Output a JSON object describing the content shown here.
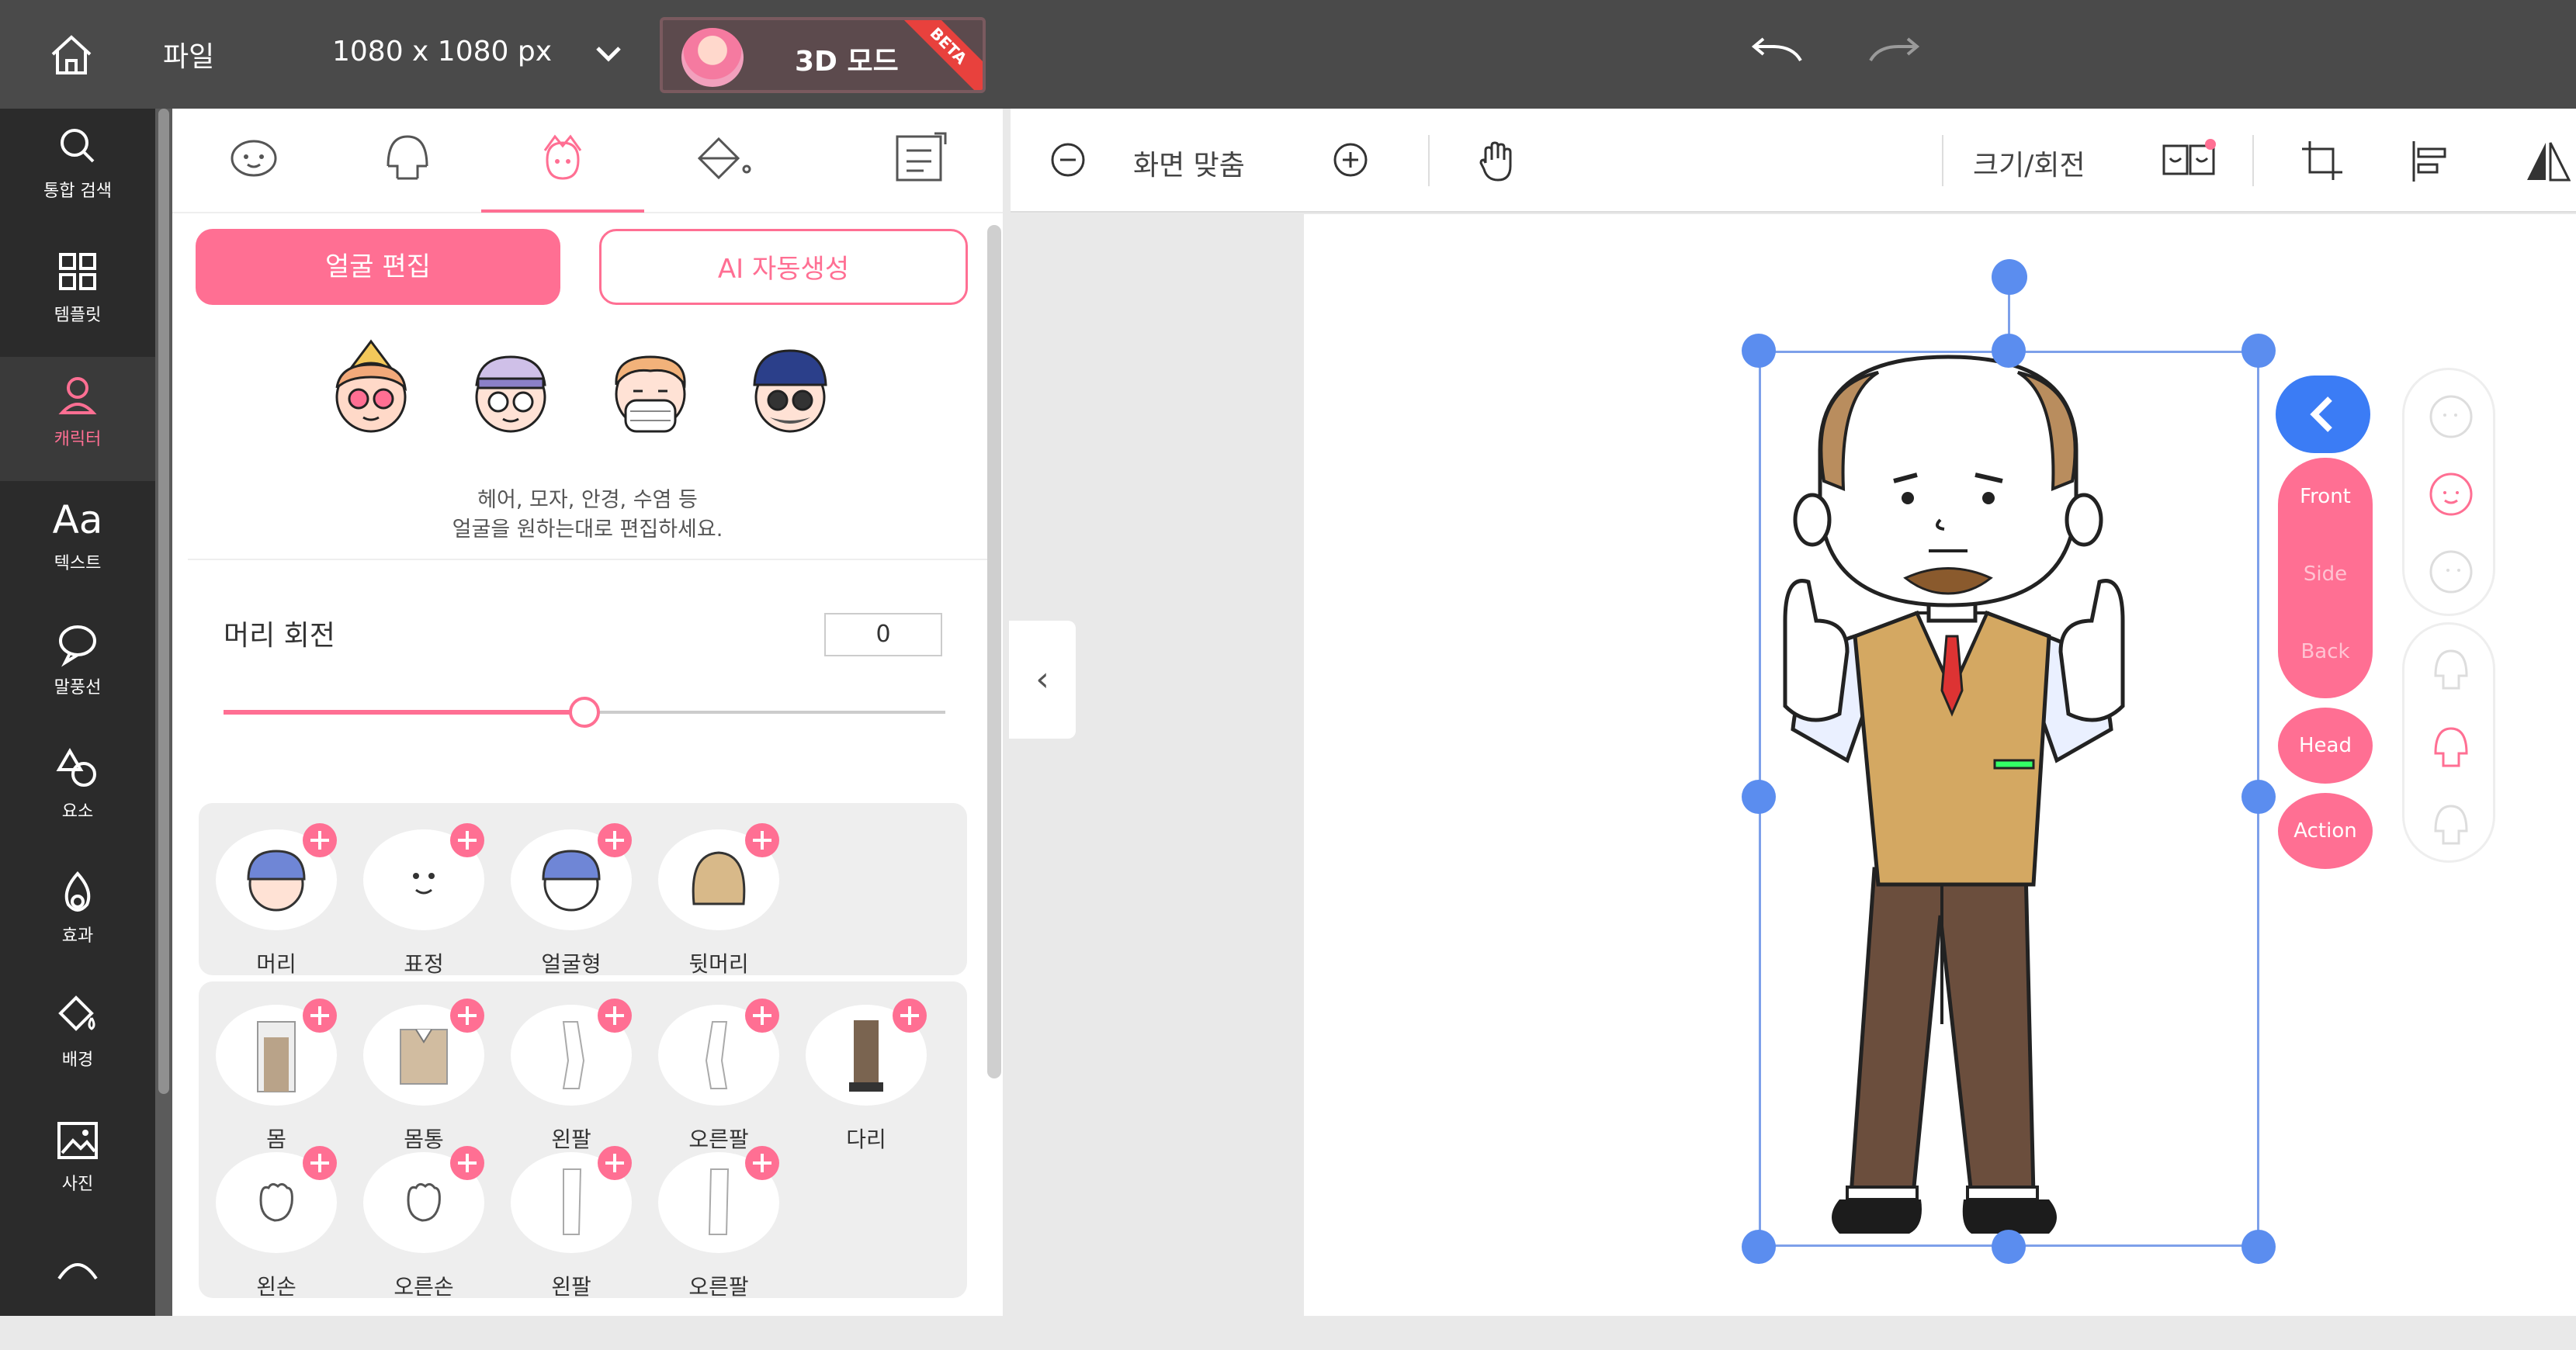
{
  "topbar": {
    "file_label": "파일",
    "canvas_size": "1080 x 1080 px",
    "mode_label": "3D 모드",
    "mode_badge": "BETA"
  },
  "leftnav": [
    {
      "label": "통합 검색",
      "icon": "search-icon"
    },
    {
      "label": "템플릿",
      "icon": "grid-icon"
    },
    {
      "label": "캐릭터",
      "icon": "user-icon",
      "active": true
    },
    {
      "label": "텍스트",
      "icon": "text-icon",
      "glyph": "Aa"
    },
    {
      "label": "말풍선",
      "icon": "speech-bubble-icon"
    },
    {
      "label": "요소",
      "icon": "shapes-icon"
    },
    {
      "label": "효과",
      "icon": "flame-icon"
    },
    {
      "label": "배경",
      "icon": "paint-bucket-icon"
    },
    {
      "label": "사진",
      "icon": "image-icon"
    }
  ],
  "panel": {
    "tabs": [
      "face-tab-icon",
      "head-tab-icon",
      "face-edit-tab-icon",
      "color-fill-tab-icon",
      "template-tab-icon"
    ],
    "face_edit_label": "얼굴 편집",
    "ai_generate_label": "AI 자동생성",
    "hint_line1": "헤어, 모자, 안경, 수염 등",
    "hint_line2": "얼굴을 원하는대로 편집하세요.",
    "rotation_label": "머리 회전",
    "rotation_value": "0",
    "rotation_fraction": 0.5,
    "head_parts": [
      "머리",
      "표정",
      "얼굴형",
      "뒷머리"
    ],
    "body_parts_row1": [
      "몸",
      "몸통",
      "왼팔",
      "오른팔",
      "다리"
    ],
    "body_parts_row2": [
      "왼손",
      "오른손",
      "왼팔",
      "오른팔"
    ]
  },
  "canvas_toolbar": {
    "zoom_fit_label": "화면 맞춤",
    "resize_label": "크기/회전"
  },
  "view_panel": {
    "front_label": "Front",
    "side_label": "Side",
    "back_label": "Back",
    "head_label": "Head",
    "action_label": "Action"
  },
  "colors": {
    "accent": "#ff6f93",
    "topbar": "#4a4a4a",
    "nav": "#2b2b2b",
    "selection": "#5b8def"
  }
}
